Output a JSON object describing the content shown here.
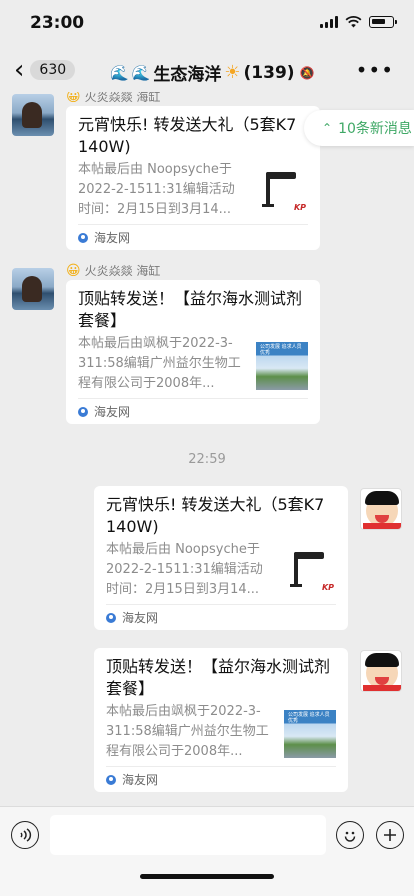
{
  "status_bar": {
    "time": "23:00"
  },
  "nav": {
    "unread_count": "630",
    "title": "生态海洋",
    "member_count": "(139)"
  },
  "new_messages": "10条新消息",
  "messages": [
    {
      "sender": "火炎焱燚 海缸",
      "title": "元宵快乐! 转发送大礼（5套K7  140W)",
      "desc": "本帖最后由 Noopsyche于2022-2-1511:31编辑活动时间：2月15日到3月14...",
      "source": "海友网",
      "thumb_logo": "KP"
    },
    {
      "sender": "火炎焱燚 海缸",
      "title": "顶贴转发送！【益尔海水测试剂套餐】",
      "desc": "本帖最后由飒枫于2022-3-311:58编辑广州益尔生物工程有限公司于2008年...",
      "source": "海友网",
      "thumb_text": "公司发展 追求人员优秀"
    }
  ],
  "timestamp": "22:59",
  "sent": [
    {
      "title": "元宵快乐! 转发送大礼（5套K7  140W)",
      "desc": "本帖最后由 Noopsyche于2022-2-1511:31编辑活动时间：2月15日到3月14...",
      "source": "海友网",
      "thumb_logo": "KP"
    },
    {
      "title": "顶贴转发送！【益尔海水测试剂套餐】",
      "desc": "本帖最后由飒枫于2022-3-311:58编辑广州益尔生物工程有限公司于2008年...",
      "source": "海友网",
      "thumb_text": "公司发展 追求人员优秀"
    }
  ],
  "icons": {
    "back": "chevron-left-icon",
    "more": "more-icon",
    "voice": "voice-icon",
    "emoji": "emoji-icon",
    "add": "plus-icon"
  },
  "colors": {
    "accent_green": "#3fa866",
    "background": "#ededed"
  }
}
